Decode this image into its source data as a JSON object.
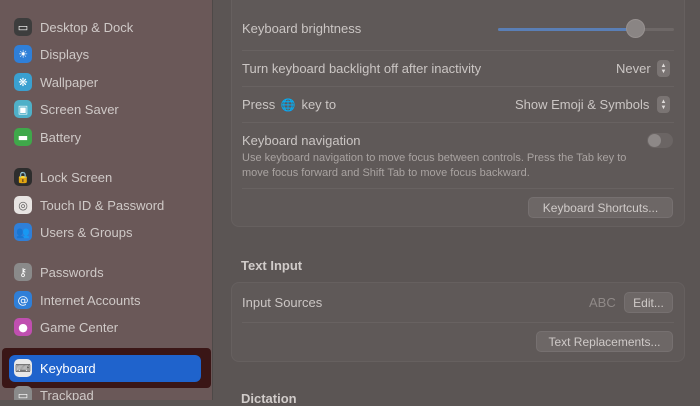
{
  "sidebar": {
    "items": [
      {
        "label": "Desktop & Dock",
        "icon": "dock-icon",
        "color": "#3d3d3d",
        "glyph": "▭"
      },
      {
        "label": "Displays",
        "icon": "displays-icon",
        "color": "#2f7fd8",
        "glyph": "☀"
      },
      {
        "label": "Wallpaper",
        "icon": "wallpaper-icon",
        "color": "#3aa0d0",
        "glyph": "❋"
      },
      {
        "label": "Screen Saver",
        "icon": "screen-saver-icon",
        "color": "#4fb0c8",
        "glyph": "▣"
      },
      {
        "label": "Battery",
        "icon": "battery-icon",
        "color": "#3fa84a",
        "glyph": "▬"
      },
      {
        "label": "Lock Screen",
        "icon": "lock-icon",
        "color": "#2d2d2d",
        "glyph": "🔒"
      },
      {
        "label": "Touch ID & Password",
        "icon": "fingerprint-icon",
        "color": "#e8e4e2",
        "glyph": "◎"
      },
      {
        "label": "Users & Groups",
        "icon": "users-icon",
        "color": "#2f7fd8",
        "glyph": "👥"
      },
      {
        "label": "Passwords",
        "icon": "key-icon",
        "color": "#8a8a8a",
        "glyph": "⚷"
      },
      {
        "label": "Internet Accounts",
        "icon": "at-icon",
        "color": "#2f7fd8",
        "glyph": "@"
      },
      {
        "label": "Game Center",
        "icon": "game-center-icon",
        "color": "#c04fb0",
        "glyph": "●"
      },
      {
        "label": "Keyboard",
        "icon": "keyboard-icon",
        "color": "#e9e9e9",
        "glyph": "⌨"
      },
      {
        "label": "Trackpad",
        "icon": "trackpad-icon",
        "color": "#8a8a8a",
        "glyph": "▭"
      }
    ]
  },
  "keyboard": {
    "brightness_label": "Keyboard brightness",
    "brightness_level": 0.78,
    "backlight_label": "Turn keyboard backlight off after inactivity",
    "backlight_value": "Never",
    "press_prefix": "Press",
    "press_suffix": "key to",
    "press_value": "Show Emoji & Symbols",
    "nav_label": "Keyboard navigation",
    "nav_desc": "Use keyboard navigation to move focus between controls. Press the Tab key to move focus forward and Shift Tab to move focus backward.",
    "shortcuts_button": "Keyboard Shortcuts..."
  },
  "text_input": {
    "title": "Text Input",
    "sources_label": "Input Sources",
    "sources_value": "ABC",
    "edit_button": "Edit...",
    "replacements_button": "Text Replacements..."
  },
  "dictation": {
    "title": "Dictation"
  }
}
